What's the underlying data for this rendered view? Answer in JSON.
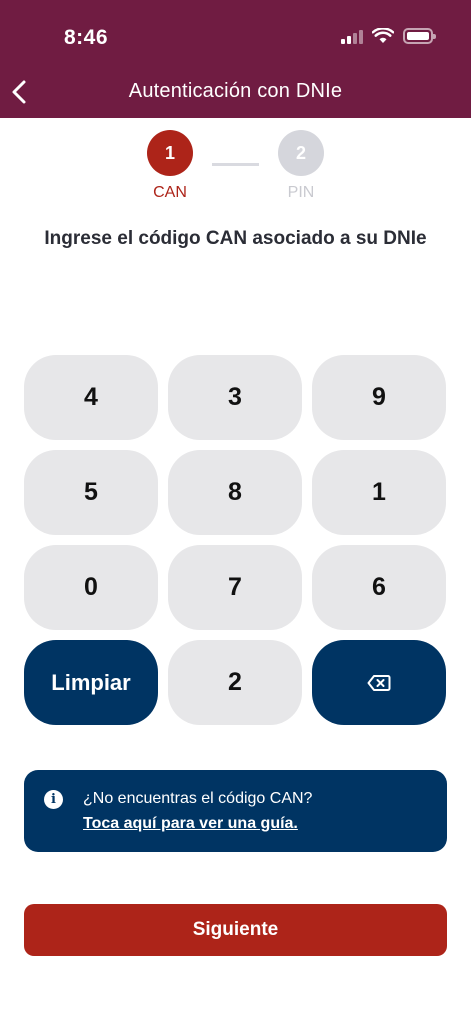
{
  "status_bar": {
    "time": "8:46"
  },
  "header": {
    "title": "Autenticación con DNIe"
  },
  "stepper": {
    "steps": [
      {
        "number": "1",
        "label": "CAN",
        "state": "active"
      },
      {
        "number": "2",
        "label": "PIN",
        "state": "inactive"
      }
    ]
  },
  "instruction": "Ingrese el código CAN asociado a su DNIe",
  "keypad": {
    "keys": [
      "4",
      "3",
      "9",
      "5",
      "8",
      "1",
      "0",
      "7",
      "6"
    ],
    "clear_label": "Limpiar",
    "last_digit": "2",
    "backspace_icon": "backspace-icon"
  },
  "help": {
    "question": "¿No encuentras el código CAN?",
    "link": "Toca aquí para ver una guía."
  },
  "next_button": "Siguiente",
  "colors": {
    "header_bg": "#701c42",
    "accent_red": "#ad2419",
    "navy": "#003463",
    "key_bg": "#e7e7e9"
  }
}
